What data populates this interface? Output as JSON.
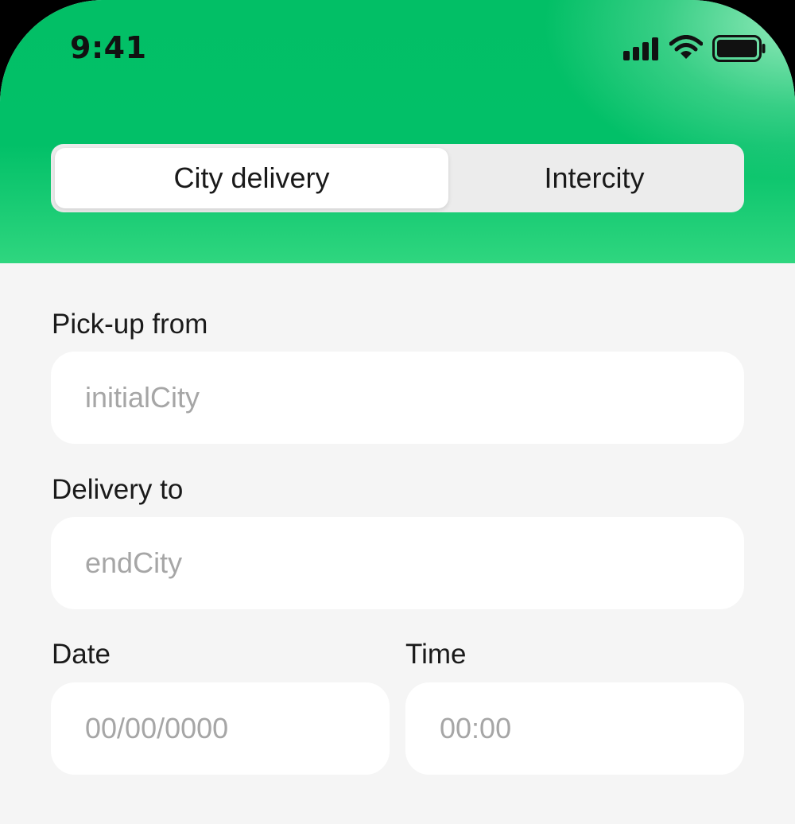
{
  "status_bar": {
    "time": "9:41",
    "icons": [
      "signal-icon",
      "wifi-icon",
      "battery-icon"
    ]
  },
  "colors": {
    "header_green": "#02c068",
    "page_background": "#f5f5f5",
    "field_background": "#ffffff",
    "placeholder": "#a6a6a6"
  },
  "delivery_type": {
    "options": [
      "City delivery",
      "Intercity"
    ],
    "selected": "City delivery"
  },
  "form": {
    "pickup": {
      "label": "Pick-up from",
      "placeholder": "initialCity",
      "value": ""
    },
    "delivery": {
      "label": "Delivery to",
      "placeholder": "endCity",
      "value": ""
    },
    "date": {
      "label": "Date",
      "placeholder": "00/00/0000",
      "value": ""
    },
    "time": {
      "label": "Time",
      "placeholder": "00:00",
      "value": ""
    }
  }
}
